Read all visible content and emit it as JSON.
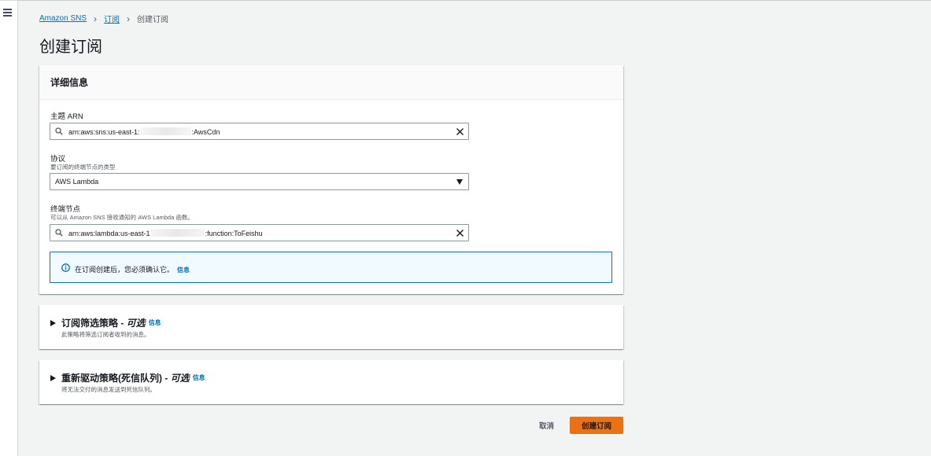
{
  "breadcrumb": {
    "items": [
      "Amazon SNS",
      "订阅"
    ],
    "current": "创建订阅"
  },
  "page_title": "创建订阅",
  "details": {
    "header": "详细信息",
    "topic_arn": {
      "label": "主题 ARN",
      "value_prefix": "arn:aws:sns:us-east-1:",
      "value_suffix": ":AwsCdn"
    },
    "protocol": {
      "label": "协议",
      "description": "要订阅的终端节点的类型",
      "selected": "AWS Lambda"
    },
    "endpoint": {
      "label": "终端节点",
      "description": "可以从 Amazon SNS 接收通知的 AWS Lambda 函数。",
      "value_prefix": "arn:aws:lambda:us-east-1",
      "value_suffix": ":function:ToFeishu"
    },
    "alert": {
      "text": "在订阅创建后，您必须确认它。",
      "info_link": "信息"
    }
  },
  "filter_policy": {
    "title": "订阅筛选策略 - ",
    "optional": "可选",
    "info_link": "信息",
    "description": "此策略将筛选订阅者收到的消息。"
  },
  "redrive_policy": {
    "title": "重新驱动策略(死信队列) - ",
    "optional": "可选",
    "info_link": "信息",
    "description": "将无法交付的消息发送到死信队列。"
  },
  "actions": {
    "cancel": "取消",
    "submit": "创建订阅"
  },
  "colors": {
    "link": "#0073bb",
    "primary": "#ec7211",
    "alert_bg": "#f1faff"
  }
}
